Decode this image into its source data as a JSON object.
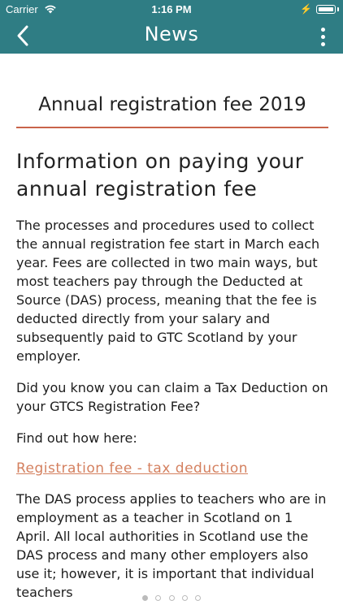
{
  "status_bar": {
    "carrier": "Carrier",
    "time": "1:16 PM"
  },
  "nav": {
    "title": "News"
  },
  "article": {
    "title": "Annual registration fee 2019",
    "headline": "Information on paying your annual registration fee",
    "paragraphs": [
      "The processes and procedures used to collect the annual registration fee start in March each year. Fees are collected in two main ways, but most teachers pay through the Deducted at Source (DAS) process, meaning that the fee is deducted directly from your salary and subsequently paid to GTC Scotland by your employer.",
      "Did you know you can claim a Tax Deduction on your GTCS Registration Fee?",
      "Find out how here:"
    ],
    "link_text": "Registration fee - tax deduction",
    "after_link": "The DAS process applies to teachers who are in employment as a teacher in Scotland on 1 April. All local authorities in Scotland use the DAS process and many other employers also use it; however, it is important that individual teachers"
  },
  "colors": {
    "header_bg": "#2f7d84",
    "accent": "#c9644a",
    "link": "#d4805f"
  },
  "icons": {
    "back": "chevron-left-icon",
    "more": "more-vertical-icon",
    "wifi": "wifi-icon",
    "battery": "battery-icon"
  }
}
